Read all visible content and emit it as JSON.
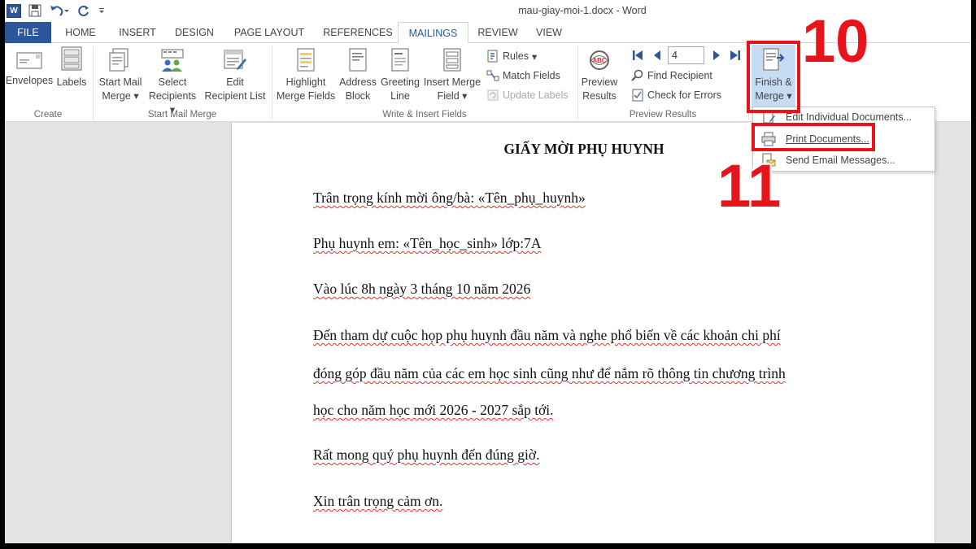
{
  "window": {
    "title": "mau-giay-moi-1.docx - Word"
  },
  "tabs": [
    {
      "label": "FILE"
    },
    {
      "label": "HOME"
    },
    {
      "label": "INSERT"
    },
    {
      "label": "DESIGN"
    },
    {
      "label": "PAGE LAYOUT"
    },
    {
      "label": "REFERENCES"
    },
    {
      "label": "MAILINGS"
    },
    {
      "label": "REVIEW"
    },
    {
      "label": "VIEW"
    }
  ],
  "ribbon": {
    "create": {
      "label": "Create",
      "envelopes": "Envelopes",
      "labels": "Labels"
    },
    "start_mail_merge": {
      "label": "Start Mail Merge",
      "start_line1": "Start Mail",
      "start_line2": "Merge",
      "select_line1": "Select",
      "select_line2": "Recipients",
      "edit_line1": "Edit",
      "edit_line2": "Recipient List"
    },
    "write_insert": {
      "label": "Write & Insert Fields",
      "highlight_line1": "Highlight",
      "highlight_line2": "Merge Fields",
      "address_line1": "Address",
      "address_line2": "Block",
      "greeting_line1": "Greeting",
      "greeting_line2": "Line",
      "insert_line1": "Insert Merge",
      "insert_line2": "Field",
      "rules": "Rules",
      "match_fields": "Match Fields",
      "update_labels": "Update Labels"
    },
    "preview": {
      "label": "Preview Results",
      "preview_line1": "Preview",
      "preview_line2": "Results",
      "record_value": "4",
      "find_recipient": "Find Recipient",
      "check_errors": "Check for Errors"
    },
    "finish": {
      "line1": "Finish &",
      "line2": "Merge"
    }
  },
  "dropdown": {
    "items": [
      {
        "label": "Edit Individual Documents..."
      },
      {
        "label": "Print Documents..."
      },
      {
        "label": "Send Email Messages..."
      }
    ]
  },
  "document": {
    "title": "GIẤY MỜI PHỤ HUYNH",
    "line1": "Trân trọng kính mời ông/bà: «Tên_phụ_huynh»",
    "line2": "Phụ huynh em: «Tên_học_sinh» lớp:7A",
    "line3": "Vào lúc 8h ngày 3 tháng 10 năm 2026",
    "line4": "Đến tham dự cuộc họp phụ huynh đầu năm và nghe phổ biến về các khoản chi phí",
    "line5": "đóng góp đầu năm của các em học sinh cũng như để nắm rõ thông tin chương trình",
    "line6": "học cho năm học mới 2026 - 2027 sắp tới.",
    "line7": "Rất mong quý phụ huynh đến đúng giờ.",
    "line8": "Xin trân trọng cảm ơn."
  },
  "annotations": {
    "step1": "10",
    "step2": "11"
  },
  "colors": {
    "accent": "#2b579a",
    "highlight": "#e8141b"
  }
}
